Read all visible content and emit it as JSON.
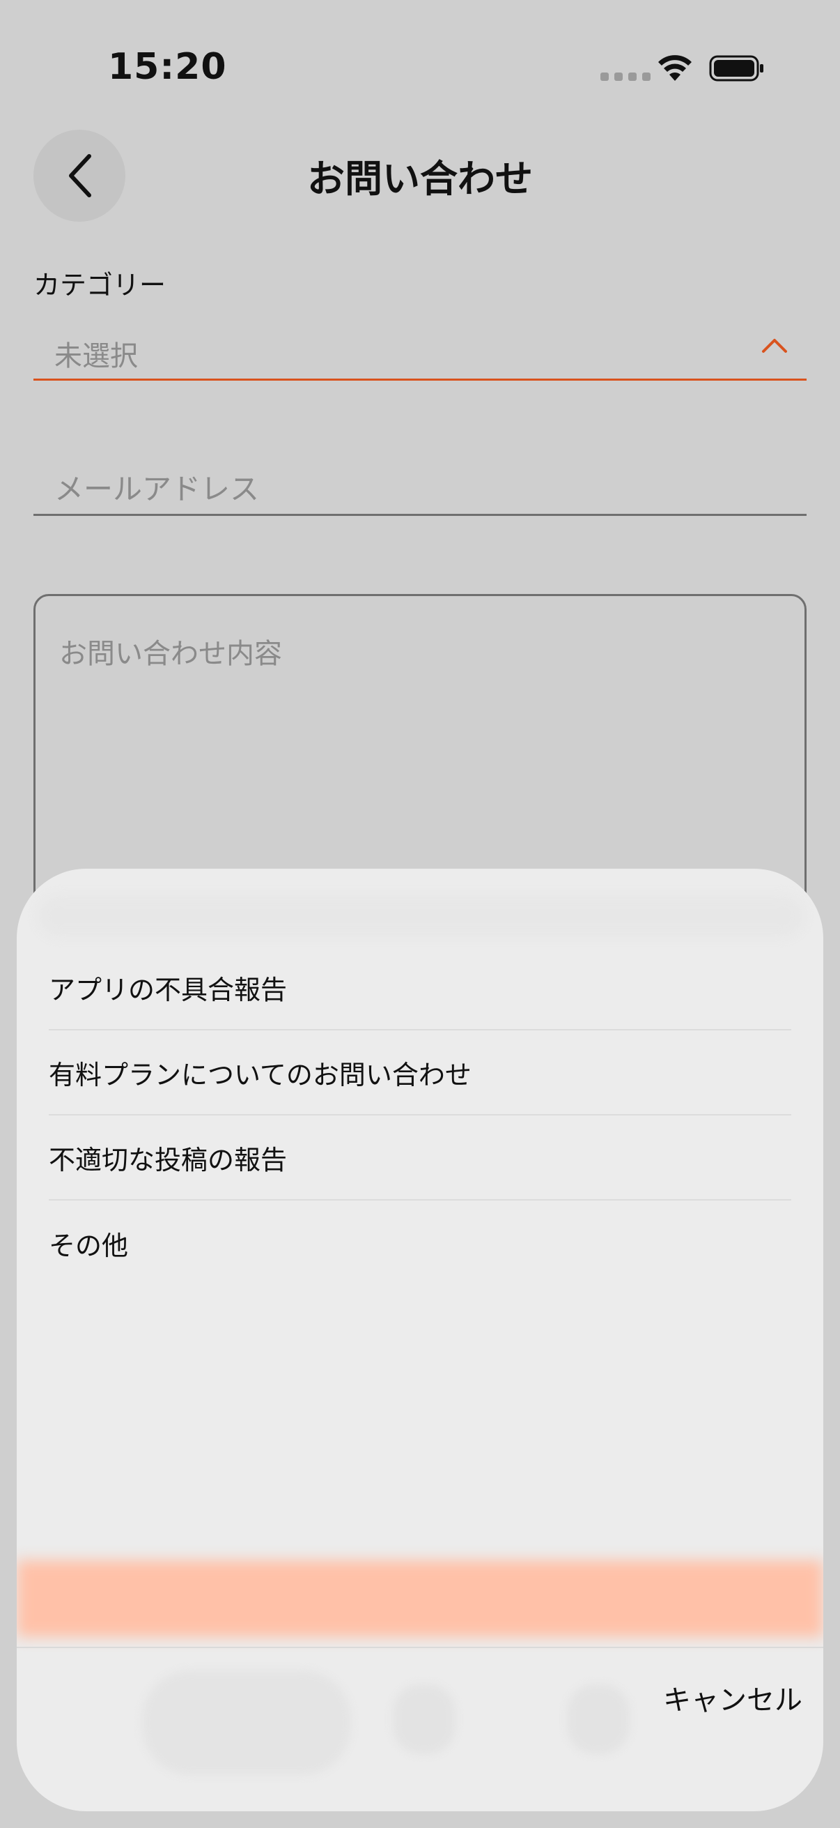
{
  "status_bar": {
    "time": "15:20"
  },
  "header": {
    "title": "お問い合わせ",
    "back_icon": "chevron-left-icon"
  },
  "form": {
    "category_label": "カテゴリー",
    "category_value": "未選択",
    "email_placeholder": "メールアドレス",
    "message_placeholder": "お問い合わせ内容"
  },
  "picker": {
    "options": [
      "アプリの不具合報告",
      "有料プランについてのお問い合わせ",
      "不適切な投稿の報告",
      "その他"
    ],
    "cancel_label": "キャンセル"
  },
  "colors": {
    "accent": "#d9531e",
    "background": "#cfcfcf",
    "sheet": "#ececec"
  }
}
